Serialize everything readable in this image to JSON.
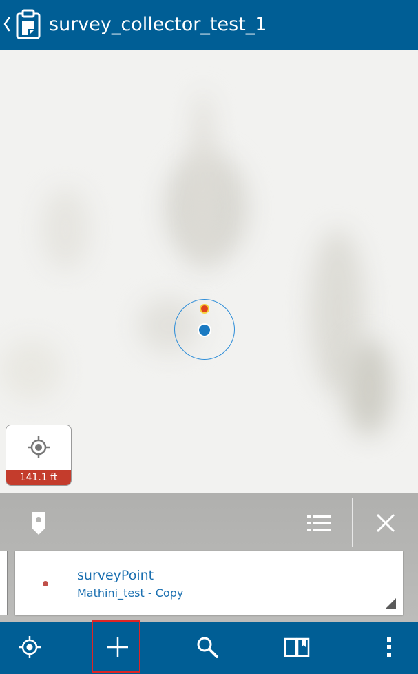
{
  "header": {
    "title": "survey_collector_test_1",
    "back_icon": "chevron-left-icon",
    "app_icon": "clipboard-map-icon"
  },
  "map": {
    "gps_accuracy": "141.1 ft",
    "location_icon": "gps-target-icon"
  },
  "panel": {
    "pin_icon": "map-pin-icon",
    "list_icon": "list-icon",
    "close_icon": "close-icon"
  },
  "feature_card": {
    "name": "surveyPoint",
    "layer": "Mathini_test - Copy",
    "symbol_color": "#c0504a"
  },
  "bottom_bar": {
    "items": [
      {
        "icon": "my-location-icon"
      },
      {
        "icon": "add-icon"
      },
      {
        "icon": "search-icon"
      },
      {
        "icon": "bookmarks-icon"
      },
      {
        "icon": "more-vert-icon"
      }
    ]
  },
  "colors": {
    "primary": "#005e95",
    "accuracy_bar": "#c43c2c",
    "location_dot": "#1a7ac2",
    "link_text": "#1a6fb0"
  }
}
